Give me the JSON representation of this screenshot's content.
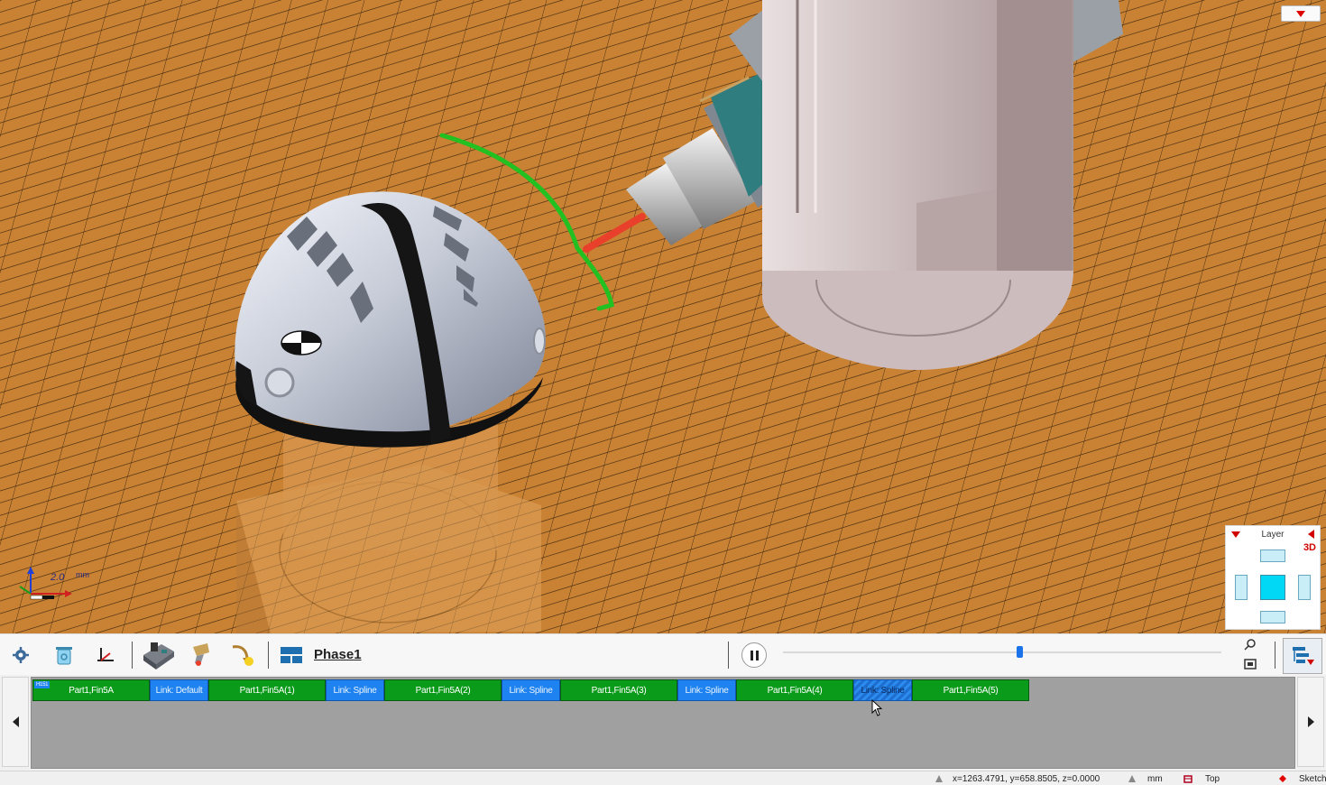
{
  "viewport": {
    "axis_unit": "2.0",
    "axis_unit_label": "mm"
  },
  "layer_panel": {
    "title": "Layer",
    "mode": "3D"
  },
  "toolbar": {
    "phase_label": "Phase1",
    "icons": [
      "settings-icon",
      "trash-icon",
      "coordinate-axes-icon",
      "machine-icon",
      "tool-icon",
      "simulate-icon",
      "phase-layout-icon"
    ]
  },
  "timeline": {
    "tag": "H151",
    "items": [
      {
        "label": "Part1,Fin5A",
        "kind": "op"
      },
      {
        "label": "Link: Default",
        "kind": "link"
      },
      {
        "label": "Part1,Fin5A(1)",
        "kind": "op"
      },
      {
        "label": "Link: Spline",
        "kind": "link"
      },
      {
        "label": "Part1,Fin5A(2)",
        "kind": "op"
      },
      {
        "label": "Link: Spline",
        "kind": "link"
      },
      {
        "label": "Part1,Fin5A(3)",
        "kind": "op"
      },
      {
        "label": "Link: Spline",
        "kind": "link"
      },
      {
        "label": "Part1,Fin5A(4)",
        "kind": "op"
      },
      {
        "label": "Link: Spline",
        "kind": "link-active"
      },
      {
        "label": "Part1,Fin5A(5)",
        "kind": "op"
      }
    ],
    "slider_position": 0.54
  },
  "status": {
    "coords": "x=1263.4791, y=658.8505, z=0.0000",
    "unit": "mm",
    "view": "Top",
    "mode": "Sketch"
  },
  "colors": {
    "floor": "#c98233",
    "operation": "#0b9b1a",
    "link": "#1e82f0",
    "toolpath": "#22c020",
    "tool": "#e8402a"
  }
}
